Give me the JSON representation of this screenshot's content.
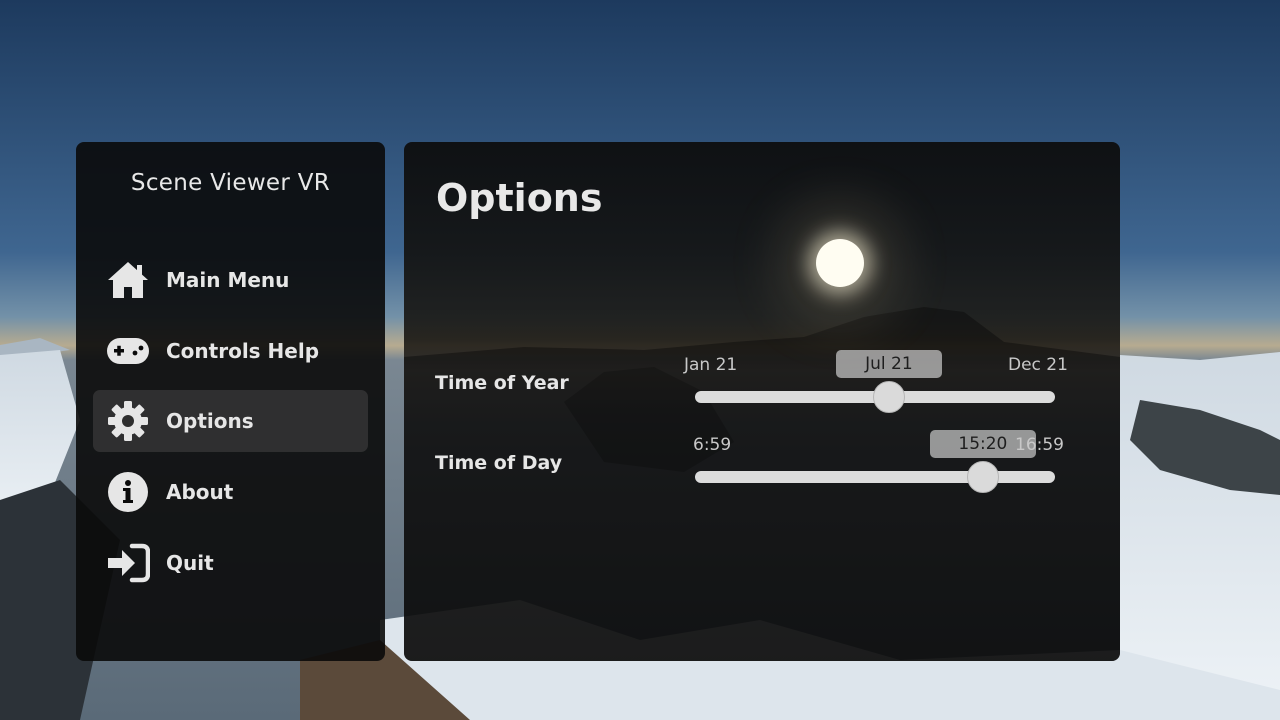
{
  "app": {
    "title": "Scene Viewer VR"
  },
  "menu": {
    "items": [
      {
        "label": "Main Menu",
        "icon": "home-icon",
        "active": false
      },
      {
        "label": "Controls Help",
        "icon": "gamepad-icon",
        "active": false
      },
      {
        "label": "Options",
        "icon": "gear-icon",
        "active": true
      },
      {
        "label": "About",
        "icon": "info-icon",
        "active": false
      },
      {
        "label": "Quit",
        "icon": "exit-icon",
        "active": false
      }
    ]
  },
  "options": {
    "title": "Options",
    "time_of_year": {
      "label": "Time of Year",
      "min_label": "Jan 21",
      "max_label": "Dec 21",
      "value_label": "Jul 21",
      "fraction": 0.54
    },
    "time_of_day": {
      "label": "Time of Day",
      "min_label": "6:59",
      "max_label": "16:59",
      "value_label": "15:20",
      "fraction": 0.81
    }
  },
  "colors": {
    "panel_bg": "#0a0a0a",
    "text": "#e6e6e6",
    "slider_track": "#dcdcdc",
    "active_item_bg": "#464646"
  }
}
